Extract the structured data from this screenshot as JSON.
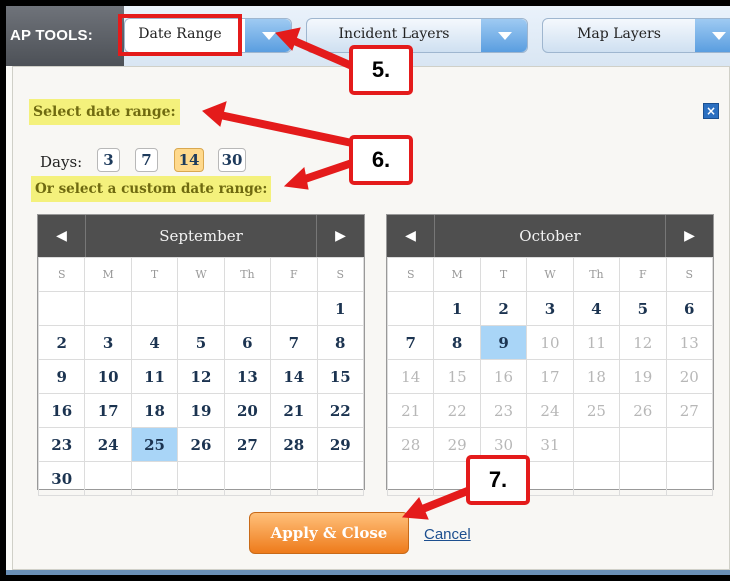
{
  "toolbar": {
    "label": "AP TOOLS:",
    "date_range": "Date Range",
    "incident_layers": "Incident Layers",
    "map_layers": "Map Layers"
  },
  "panel": {
    "select_range": "Select date range:",
    "days_label": "Days:",
    "day_options": [
      "3",
      "7",
      "14",
      "30"
    ],
    "selected_days": "14",
    "custom_range": "Or select a custom date range:",
    "close_glyph": "×"
  },
  "weekdays": [
    "S",
    "M",
    "T",
    "W",
    "Th",
    "F",
    "S"
  ],
  "calendars": [
    {
      "month": "September",
      "prev": "◀",
      "next": "▶",
      "weeks": [
        [
          "",
          "",
          "",
          "",
          "",
          "",
          "1"
        ],
        [
          "2",
          "3",
          "4",
          "5",
          "6",
          "7",
          "8"
        ],
        [
          "9",
          "10",
          "11",
          "12",
          "13",
          "14",
          "15"
        ],
        [
          "16",
          "17",
          "18",
          "19",
          "20",
          "21",
          "22"
        ],
        [
          "23",
          "24",
          "25",
          "26",
          "27",
          "28",
          "29"
        ],
        [
          "30",
          "",
          "",
          "",
          "",
          "",
          ""
        ]
      ],
      "highlight": "25",
      "dim_after": null
    },
    {
      "month": "October",
      "prev": "◀",
      "next": "▶",
      "weeks": [
        [
          "",
          "1",
          "2",
          "3",
          "4",
          "5",
          "6"
        ],
        [
          "7",
          "8",
          "9",
          "10",
          "11",
          "12",
          "13"
        ],
        [
          "14",
          "15",
          "16",
          "17",
          "18",
          "19",
          "20"
        ],
        [
          "21",
          "22",
          "23",
          "24",
          "25",
          "26",
          "27"
        ],
        [
          "28",
          "29",
          "30",
          "31",
          "",
          "",
          ""
        ],
        [
          "",
          "",
          "",
          "",
          "",
          "",
          ""
        ]
      ],
      "highlight": "9",
      "dim_after": 9
    }
  ],
  "buttons": {
    "apply": "Apply & Close",
    "cancel": "Cancel"
  },
  "annotations": {
    "step5": "5.",
    "step6": "6.",
    "step7": "7.",
    "color": "#e41b1b"
  }
}
